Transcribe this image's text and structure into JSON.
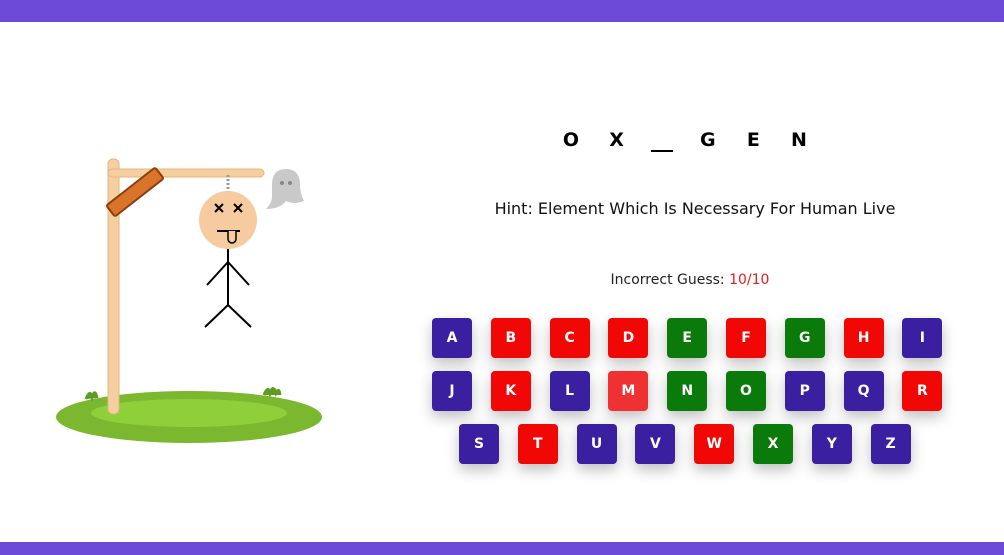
{
  "word": [
    "O",
    "X",
    "",
    "G",
    "E",
    "N"
  ],
  "hint": "Hint: Element Which Is Necessary For Human Live",
  "incorrect": {
    "label": "Incorrect Guess: ",
    "count": "10/10"
  },
  "keys": [
    {
      "letter": "A",
      "state": "neutral"
    },
    {
      "letter": "B",
      "state": "wrong"
    },
    {
      "letter": "C",
      "state": "wrong"
    },
    {
      "letter": "D",
      "state": "wrong"
    },
    {
      "letter": "E",
      "state": "right"
    },
    {
      "letter": "F",
      "state": "wrong"
    },
    {
      "letter": "G",
      "state": "right"
    },
    {
      "letter": "H",
      "state": "wrong"
    },
    {
      "letter": "I",
      "state": "neutral"
    },
    {
      "letter": "J",
      "state": "neutral"
    },
    {
      "letter": "K",
      "state": "wrong"
    },
    {
      "letter": "L",
      "state": "neutral"
    },
    {
      "letter": "M",
      "state": "hover"
    },
    {
      "letter": "N",
      "state": "right"
    },
    {
      "letter": "O",
      "state": "right"
    },
    {
      "letter": "P",
      "state": "neutral"
    },
    {
      "letter": "Q",
      "state": "neutral"
    },
    {
      "letter": "R",
      "state": "wrong"
    },
    {
      "letter": "S",
      "state": "neutral"
    },
    {
      "letter": "T",
      "state": "wrong"
    },
    {
      "letter": "U",
      "state": "neutral"
    },
    {
      "letter": "V",
      "state": "neutral"
    },
    {
      "letter": "W",
      "state": "wrong"
    },
    {
      "letter": "X",
      "state": "right"
    },
    {
      "letter": "Y",
      "state": "neutral"
    },
    {
      "letter": "Z",
      "state": "neutral"
    }
  ],
  "colors": {
    "header_bar": "#6d4bd8",
    "key_neutral": "#3a1fa0",
    "key_wrong": "#f20707",
    "key_right": "#0a7a0a",
    "incorrect_count": "#e01e1e"
  },
  "icons": [
    "gallows",
    "hanged-stickman",
    "ghost-icon",
    "grass-mound"
  ]
}
